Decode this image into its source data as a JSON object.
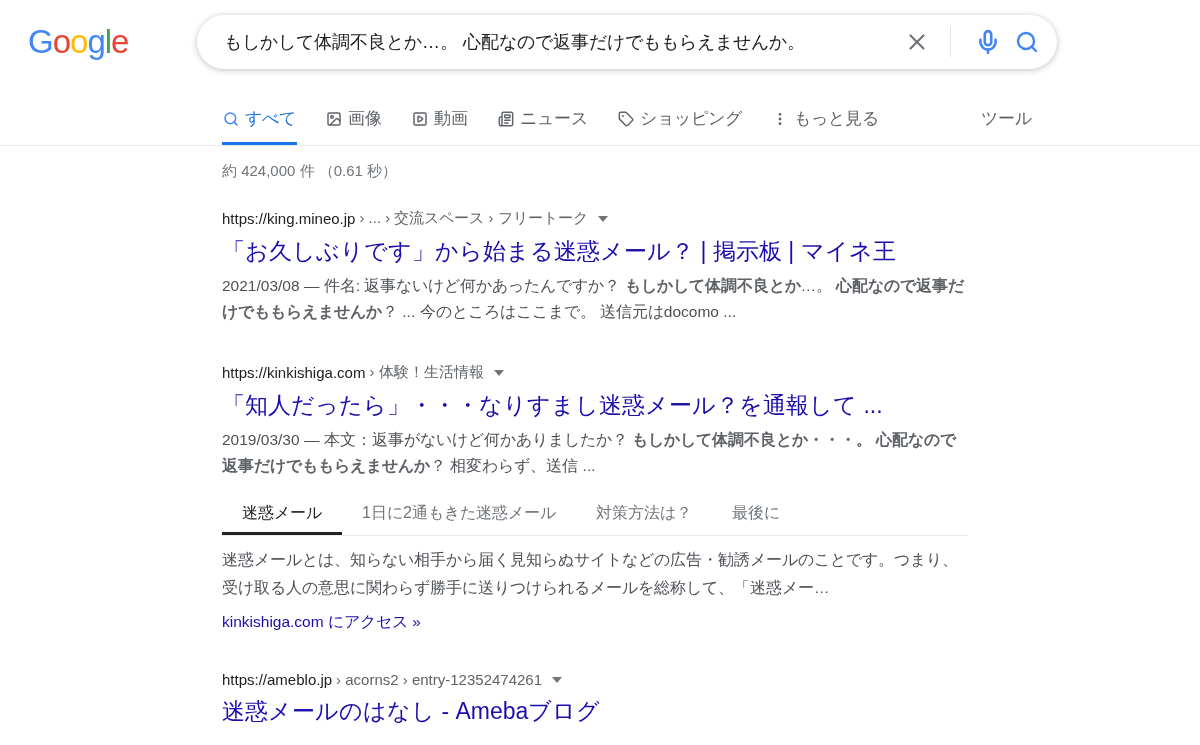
{
  "logo": "Google",
  "search": {
    "value": "もしかして体調不良とか…。 心配なので返事だけでももらえませんか。"
  },
  "tabs": [
    {
      "kind": "all",
      "label": "すべて",
      "selected": true
    },
    {
      "kind": "images",
      "label": "画像",
      "selected": false
    },
    {
      "kind": "videos",
      "label": "動画",
      "selected": false
    },
    {
      "kind": "news",
      "label": "ニュース",
      "selected": false
    },
    {
      "kind": "shopping",
      "label": "ショッピング",
      "selected": false
    },
    {
      "kind": "more",
      "label": "もっと見る",
      "selected": false
    }
  ],
  "tools": "ツール",
  "result_stats": "約 424,000 件 （0.61 秒）",
  "results": [
    {
      "url_host": "https://king.mineo.jp",
      "url_path": " › ... › 交流スペース › フリートーク",
      "title": "「お久しぶりです」から始まる迷惑メール？ | 掲示板 | マイネ王",
      "snippet": "2021/03/08 — 件名: 返事ないけど何かあったんですか？ **もしかして体調不良とか**…。 **心配なので返事だけでももらえませんか**？ ... 今のところはここまで。 送信元はdocomo ..."
    },
    {
      "url_host": "https://kinkishiga.com",
      "url_path": " › 体験！生活情報",
      "title": "「知人だったら」・・・なりすまし迷惑メール？を通報して ...",
      "snippet": "2019/03/30 — 本文：返事がないけど何かありましたか？ **もしかして体調不良とか・・・。 心配なので返事だけでももらえませんか**？ 相変わらず、送信 ...",
      "sub_tabs": [
        {
          "label": "迷惑メール",
          "selected": true
        },
        {
          "label": "1日に2通もきた迷惑メール",
          "selected": false
        },
        {
          "label": "対策方法は？",
          "selected": false
        },
        {
          "label": "最後に",
          "selected": false
        }
      ],
      "sub_text": "迷惑メールとは、知らない相手から届く見知らぬサイトなどの広告・勧誘メールのことです。つまり、受け取る人の意思に関わらず勝手に送りつけられるメールを総称して、「迷惑メー…",
      "sub_link": "kinkishiga.com にアクセス »"
    },
    {
      "url_host": "https://ameblo.jp",
      "url_path": " › acorns2 › entry-12352474261",
      "title": "迷惑メールのはなし - Amebaブログ"
    }
  ]
}
